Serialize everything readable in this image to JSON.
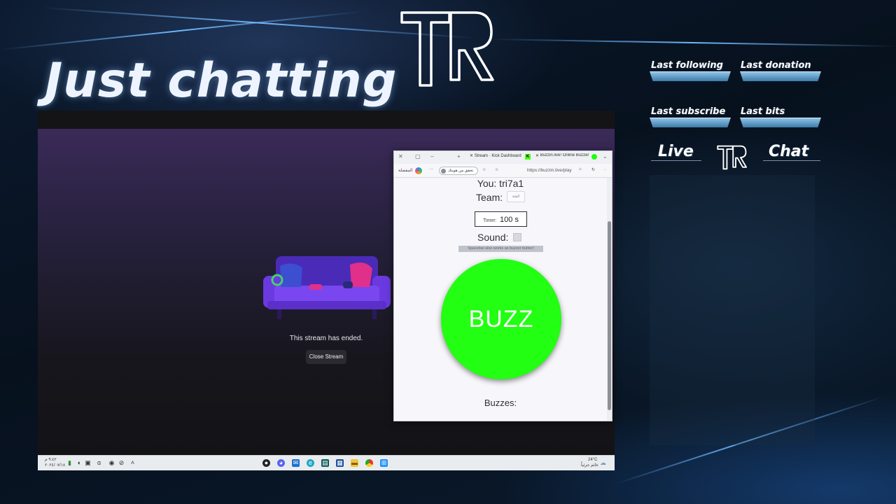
{
  "overlay": {
    "title": "Just chatting",
    "stats": [
      {
        "label": "Last following"
      },
      {
        "label": "Last donation"
      },
      {
        "label": "Last subscribe"
      },
      {
        "label": "Last bits"
      }
    ],
    "nav_left": "Live",
    "nav_right": "Chat"
  },
  "stream": {
    "ended_text": "This stream has ended.",
    "close_button": "Close Stream"
  },
  "browser": {
    "tabs": [
      "Stream · Kick Dashboard",
      "Buzzin.live! Online Buzzer"
    ],
    "url": "https://buzzin.live/play",
    "profile_label": "تحقق من هويتك",
    "favorites_label": "المفضلة"
  },
  "buzzer_page": {
    "you": "You: tri7a1",
    "team_label": "Team:",
    "team_select": "الفئة",
    "timer_label": "Timer:",
    "timer_value": "100 s",
    "sound_label": "Sound:",
    "hint": "Spacebar also works as buzzer button!",
    "buzz_label": "BUZZ",
    "buzzes_label": "Buzzes:"
  },
  "taskbar": {
    "clock_time": "٩:٤٢ م",
    "clock_date": "٢٠٢٤/٠٧/١٨",
    "weather_temp": "24°C",
    "weather_desc": "غائم جزئياً"
  },
  "colors": {
    "buzz": "#22ff12",
    "accent": "#6fb8ff"
  }
}
